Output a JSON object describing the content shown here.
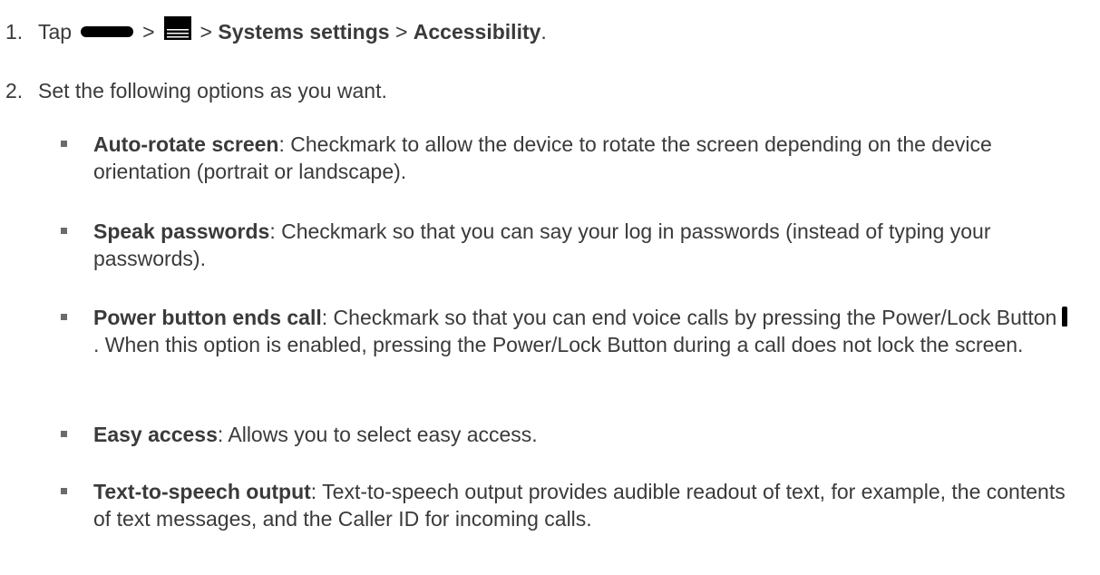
{
  "steps": [
    {
      "number": "1.",
      "tap_label": "Tap",
      "sep": ">",
      "systems_settings": "Systems settings",
      "accessibility": "Accessibility",
      "end": ".",
      "icons": [
        "home-button-icon",
        "menu-icon"
      ]
    },
    {
      "number": "2.",
      "text": "Set the following options as you want."
    }
  ],
  "options": [
    {
      "title": "Auto-rotate screen",
      "desc": ": Checkmark to allow the device to rotate the screen depending on the device orientation (portrait or landscape)."
    },
    {
      "title": "Speak passwords",
      "desc": ": Checkmark so that you can say your log in passwords (instead of typing your passwords)."
    },
    {
      "title": "Power button ends call",
      "desc_before_icon": ": Checkmark so that you can end voice calls by pressing the Power/Lock Button",
      "desc_after_icon": ". When this option is enabled, pressing the Power/Lock Button during a call does not lock the screen.",
      "icon": "power-lock-button-icon"
    },
    {
      "title": "Easy access",
      "desc": ": Allows you to select easy access."
    },
    {
      "title": "Text-to-speech output",
      "desc": ": Text-to-speech output provides audible readout of text, for example, the contents of text messages, and the Caller ID for incoming calls."
    }
  ],
  "colors": {
    "text": "#3a3a3a",
    "icon": "#000000",
    "bullet": "#6b6b6b"
  }
}
